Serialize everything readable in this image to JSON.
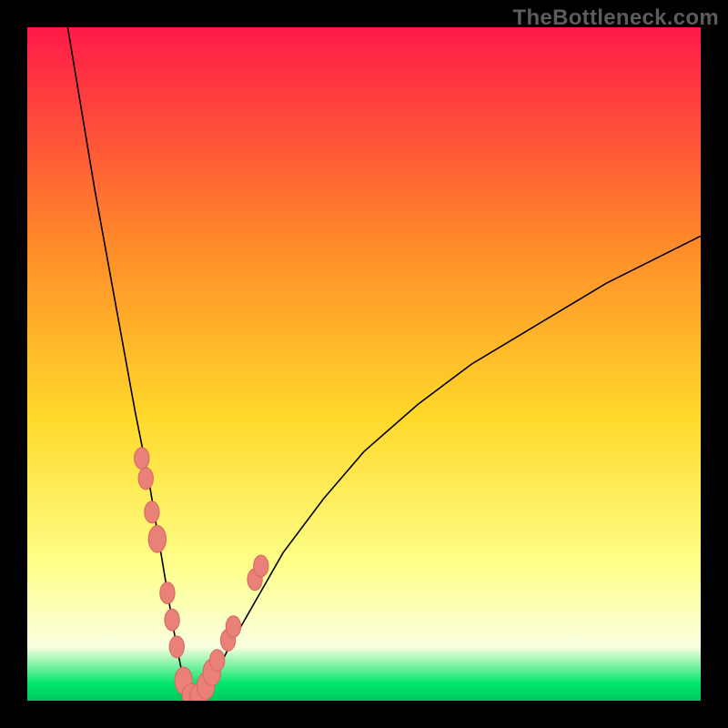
{
  "watermark": "TheBottleneck.com",
  "colors": {
    "frame": "#000000",
    "gradient_top": "#ff1a49",
    "gradient_mid_upper": "#ff8a2a",
    "gradient_mid": "#ffd92a",
    "gradient_mid_lower": "#feff8a",
    "gradient_pale": "#faffe0",
    "gradient_green": "#00e668",
    "curve": "#000000",
    "dot_fill": "#e98178",
    "dot_stroke": "#d96a62"
  },
  "chart_data": {
    "type": "line",
    "title": "",
    "xlabel": "",
    "ylabel": "",
    "xlim": [
      0,
      100
    ],
    "ylim": [
      0,
      100
    ],
    "series": [
      {
        "name": "bottleneck-curve",
        "x": [
          6,
          8,
          10,
          12,
          14,
          16,
          17,
          18,
          19,
          20,
          21,
          22,
          23,
          24,
          25,
          27,
          30,
          34,
          38,
          44,
          50,
          58,
          66,
          76,
          86,
          96,
          100
        ],
        "y": [
          100,
          88,
          76,
          65,
          54,
          43,
          38,
          33,
          27,
          21,
          15,
          9,
          4,
          1,
          0,
          2,
          8,
          15,
          22,
          30,
          37,
          44,
          50,
          56,
          62,
          67,
          69
        ]
      }
    ],
    "dots": {
      "name": "highlighted-points",
      "x": [
        17.0,
        17.6,
        18.5,
        19.3,
        20.8,
        21.5,
        22.2,
        23.2,
        24.4,
        25.6,
        26.5,
        27.4,
        28.2,
        29.8,
        30.6,
        33.8,
        34.7
      ],
      "y": [
        36,
        33,
        28,
        24,
        16,
        12,
        8,
        3,
        0.8,
        0.8,
        2.2,
        4.2,
        6,
        9,
        11,
        18,
        20
      ],
      "rx": [
        1.1,
        1.1,
        1.1,
        1.3,
        1.1,
        1.1,
        1.1,
        1.3,
        1.4,
        1.4,
        1.3,
        1.3,
        1.1,
        1.1,
        1.1,
        1.1,
        1.1
      ],
      "ry": [
        1.6,
        1.6,
        1.6,
        2.0,
        1.6,
        1.6,
        1.6,
        2.0,
        1.7,
        1.7,
        2.0,
        2.0,
        1.6,
        1.6,
        1.6,
        1.6,
        1.6
      ]
    }
  }
}
